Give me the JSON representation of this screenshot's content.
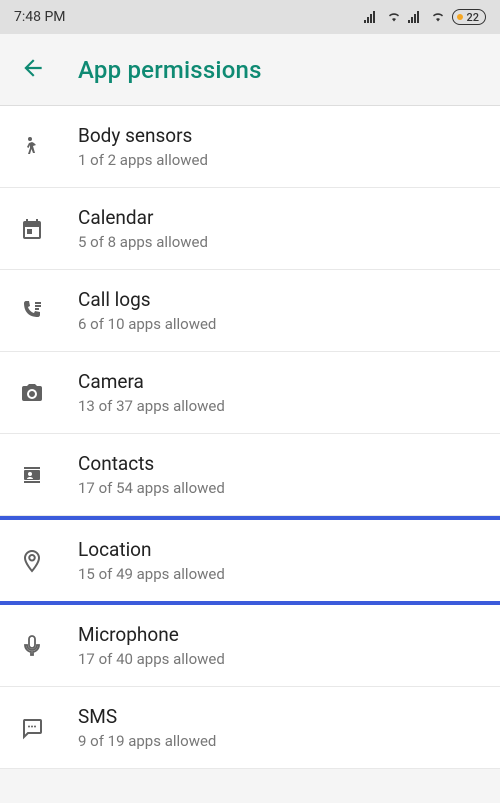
{
  "status": {
    "time": "7:48 PM",
    "battery": "22"
  },
  "header": {
    "title": "App permissions"
  },
  "permissions": [
    {
      "id": "body-sensors",
      "label": "Body sensors",
      "sub": "1 of 2 apps allowed",
      "highlighted": false
    },
    {
      "id": "calendar",
      "label": "Calendar",
      "sub": "5 of 8 apps allowed",
      "highlighted": false
    },
    {
      "id": "call-logs",
      "label": "Call logs",
      "sub": "6 of 10 apps allowed",
      "highlighted": false
    },
    {
      "id": "camera",
      "label": "Camera",
      "sub": "13 of 37 apps allowed",
      "highlighted": false
    },
    {
      "id": "contacts",
      "label": "Contacts",
      "sub": "17 of 54 apps allowed",
      "highlighted": false
    },
    {
      "id": "location",
      "label": "Location",
      "sub": "15 of 49 apps allowed",
      "highlighted": true
    },
    {
      "id": "microphone",
      "label": "Microphone",
      "sub": "17 of 40 apps allowed",
      "highlighted": false
    },
    {
      "id": "sms",
      "label": "SMS",
      "sub": "9 of 19 apps allowed",
      "highlighted": false
    }
  ]
}
